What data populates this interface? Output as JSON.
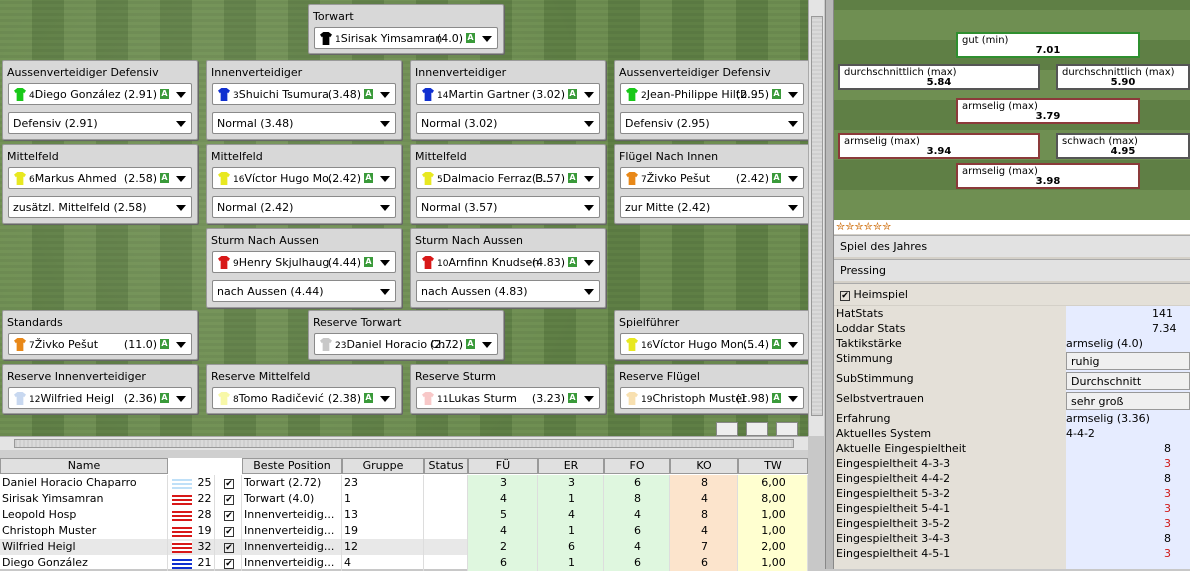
{
  "positions": {
    "gk": {
      "title": "Torwart",
      "num": "1",
      "name": "Sirisak Yimsamran",
      "rating": "(4.0)",
      "color": "#000000"
    },
    "ld": {
      "title": "Aussenverteidiger Defensiv",
      "num": "4",
      "name": "Diego González",
      "rating": "(2.91)",
      "color": "#18c818",
      "sub": "Defensiv (2.91)"
    },
    "cd1": {
      "title": "Innenverteidiger",
      "num": "3",
      "name": "Shuichi Tsumura",
      "rating": "(3.48)",
      "color": "#1030d0",
      "sub": "Normal (3.48)"
    },
    "cd2": {
      "title": "Innenverteidiger",
      "num": "14",
      "name": "Martin Gartner",
      "rating": "(3.02)",
      "color": "#1030d0",
      "sub": "Normal (3.02)"
    },
    "rd": {
      "title": "Aussenverteidiger Defensiv",
      "num": "2",
      "name": "Jean-Philippe Hiltb...",
      "rating": "(2.95)",
      "color": "#18c818",
      "sub": "Defensiv (2.95)"
    },
    "m1": {
      "title": "Mittelfeld",
      "num": "6",
      "name": "Markus Ahmed",
      "rating": "(2.58)",
      "color": "#e8e820",
      "sub": "zusätzl. Mittelfeld (2.58)"
    },
    "m2": {
      "title": "Mittelfeld",
      "num": "16",
      "name": "Víctor Hugo Mo...",
      "rating": "(2.42)",
      "color": "#e8e820",
      "sub": "Normal (2.42)"
    },
    "m3": {
      "title": "Mittelfeld",
      "num": "5",
      "name": "Dalmacio Ferraz E...",
      "rating": "(3.57)",
      "color": "#e8e820",
      "sub": "Normal (3.57)"
    },
    "w1": {
      "title": "Flügel Nach Innen",
      "num": "7",
      "name": "Živko Pešut",
      "rating": "(2.42)",
      "color": "#e88818",
      "sub": "zur Mitte (2.42)"
    },
    "f1": {
      "title": "Sturm Nach Aussen",
      "num": "9",
      "name": "Henry Skjulhaug",
      "rating": "(4.44)",
      "color": "#d81818",
      "sub": "nach Aussen (4.44)"
    },
    "f2": {
      "title": "Sturm Nach Aussen",
      "num": "10",
      "name": "Arnfinn Knudsen",
      "rating": "(4.83)",
      "color": "#d81818",
      "sub": "nach Aussen (4.83)"
    },
    "set": {
      "title": "Standards",
      "num": "7",
      "name": "Živko Pešut",
      "rating": "(11.0)",
      "color": "#e88818"
    },
    "rgk": {
      "title": "Reserve Torwart",
      "num": "23",
      "name": "Daniel Horacio Ch...",
      "rating": "(2.72)",
      "color": "#c8c8c8"
    },
    "cap": {
      "title": "Spielführer",
      "num": "16",
      "name": "Víctor Hugo Mon...",
      "rating": "(5.4)",
      "color": "#e8e820"
    },
    "rcd": {
      "title": "Reserve Innenverteidiger",
      "num": "12",
      "name": "Wilfried Heigl",
      "rating": "(2.36)",
      "color": "#c8d8f0"
    },
    "rm": {
      "title": "Reserve Mittelfeld",
      "num": "8",
      "name": "Tomo Radičević",
      "rating": "(2.38)",
      "color": "#f8f8a8"
    },
    "rf": {
      "title": "Reserve Sturm",
      "num": "11",
      "name": "Lukas Sturm",
      "rating": "(3.23)",
      "color": "#f8c8c8"
    },
    "rw": {
      "title": "Reserve Flügel",
      "num": "19",
      "name": "Christoph Muster",
      "rating": "(1.98)",
      "color": "#f8e0b0"
    }
  },
  "ratings": [
    {
      "label": "gut (min)",
      "value": "7.01"
    },
    {
      "label": "durchschnittlich (max)",
      "value": "5.84"
    },
    {
      "label": "durchschnittlich (max)",
      "value": "5.90"
    },
    {
      "label": "armselig (max)",
      "value": "3.79"
    },
    {
      "label": "armselig (max)",
      "value": "3.94"
    },
    {
      "label": "schwach (max)",
      "value": "4.95"
    },
    {
      "label": "armselig (max)",
      "value": "3.98"
    }
  ],
  "stars": "✮✮✮✮✮✮",
  "match_type": "Spiel des Jahres",
  "tactic": "Pressing",
  "home_label": "Heimspiel",
  "stats": {
    "hatstats": {
      "label": "HatStats",
      "value": "141"
    },
    "loddar": {
      "label": "Loddar Stats",
      "value": "7.34"
    },
    "taktik": {
      "label": "Taktikstärke",
      "value": "armselig (4.0)"
    },
    "stimmung": {
      "label": "Stimmung",
      "value": "ruhig"
    },
    "substimmung": {
      "label": "SubStimmung",
      "value": "Durchschnitt"
    },
    "selbst": {
      "label": "Selbstvertrauen",
      "value": "sehr groß"
    },
    "erfahrung": {
      "label": "Erfahrung",
      "value": "armselig (3.36)"
    },
    "system": {
      "label": "Aktuelles System",
      "value": "4-4-2"
    },
    "e_akt": {
      "label": "Aktuelle Eingespieltheit",
      "value": "8"
    },
    "e433": {
      "label": "Eingespieltheit 4-3-3",
      "value": "3"
    },
    "e442": {
      "label": "Eingespieltheit 4-4-2",
      "value": "8"
    },
    "e532": {
      "label": "Eingespieltheit 5-3-2",
      "value": "3"
    },
    "e541": {
      "label": "Eingespieltheit 5-4-1",
      "value": "3"
    },
    "e352": {
      "label": "Eingespieltheit 3-5-2",
      "value": "3"
    },
    "e343": {
      "label": "Eingespieltheit 3-4-3",
      "value": "8"
    },
    "e451": {
      "label": "Eingespieltheit 4-5-1",
      "value": "3"
    }
  },
  "table": {
    "headers": {
      "name": "Name",
      "pos": "Beste Position",
      "grp": "Gruppe",
      "status": "Status",
      "fu": "FÜ",
      "er": "ER",
      "fo": "FO",
      "ko": "KO",
      "tw": "TW"
    },
    "rows": [
      {
        "name": "Daniel Horacio Chaparro",
        "age": "25",
        "pos": "Torwart (2.72)",
        "num": "23",
        "fu": "3",
        "er": "3",
        "fo": "6",
        "ko": "8",
        "tw": "6,00"
      },
      {
        "name": "Sirisak Yimsamran",
        "age": "22",
        "pos": "Torwart (4.0)",
        "num": "1",
        "fu": "4",
        "er": "1",
        "fo": "8",
        "ko": "4",
        "tw": "8,00"
      },
      {
        "name": "Leopold Hosp",
        "age": "28",
        "pos": "Innenverteidig...",
        "num": "13",
        "fu": "5",
        "er": "4",
        "fo": "4",
        "ko": "8",
        "tw": "1,00"
      },
      {
        "name": "Christoph Muster",
        "age": "19",
        "pos": "Innenverteidig...",
        "num": "19",
        "fu": "4",
        "er": "1",
        "fo": "6",
        "ko": "4",
        "tw": "1,00"
      },
      {
        "name": "Wilfried Heigl",
        "age": "32",
        "pos": "Innenverteidig...",
        "num": "12",
        "fu": "2",
        "er": "6",
        "fo": "4",
        "ko": "7",
        "tw": "2,00"
      },
      {
        "name": "Diego González",
        "age": "21",
        "pos": "Innenverteidig...",
        "num": "4",
        "fu": "6",
        "er": "1",
        "fo": "6",
        "ko": "6",
        "tw": "1,00"
      }
    ]
  },
  "a_badge": "A",
  "check": "✔"
}
